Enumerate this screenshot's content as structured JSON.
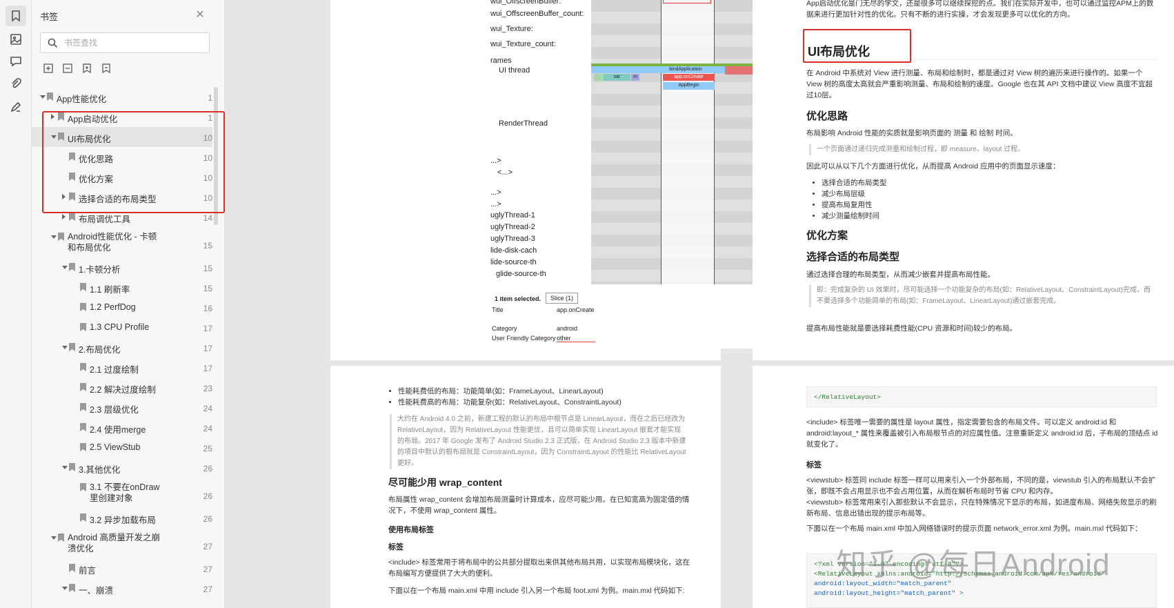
{
  "panel": {
    "title": "书签",
    "search_placeholder": "书签查找"
  },
  "rail": {
    "icons": [
      "bookmark-icon",
      "image-icon",
      "comment-icon",
      "attachment-icon",
      "signature-icon"
    ]
  },
  "tree": [
    {
      "label": "App性能优化",
      "page": "1"
    },
    {
      "label": "App启动优化",
      "page": "1"
    },
    {
      "label": "UI布局优化",
      "page": "10"
    },
    {
      "label": "优化思路",
      "page": "10"
    },
    {
      "label": "优化方案",
      "page": "10"
    },
    {
      "label": "选择合适的布局类型",
      "page": "10"
    },
    {
      "label": "布局调优工具",
      "page": "14"
    },
    {
      "label": "Android性能优化 - 卡顿和布局优化",
      "page": "15"
    },
    {
      "label": "1.卡顿分析",
      "page": "15"
    },
    {
      "label": "1.1 刷新率",
      "page": "15"
    },
    {
      "label": "1.2 PerfDog",
      "page": "16"
    },
    {
      "label": "1.3 CPU Profile",
      "page": "17"
    },
    {
      "label": "2.布局优化",
      "page": "17"
    },
    {
      "label": "2.1 过度绘制",
      "page": "17"
    },
    {
      "label": "2.2 解决过度绘制",
      "page": "23"
    },
    {
      "label": "2.3 层级优化",
      "page": "24"
    },
    {
      "label": "2.4 使用merge",
      "page": "24"
    },
    {
      "label": "2.5 ViewStub",
      "page": "25"
    },
    {
      "label": "3.其他优化",
      "page": "26"
    },
    {
      "label": "3.1 不要在onDraw里创建对象",
      "page": "26"
    },
    {
      "label": "3.2 异步加载布局",
      "page": "26"
    },
    {
      "label": "Android 高质量开发之崩溃优化",
      "page": "27"
    },
    {
      "label": "前言",
      "page": "27"
    },
    {
      "label": "一、崩溃",
      "page": "27"
    }
  ],
  "trace": {
    "lanes": [
      "wui_OffscreenBuffer:",
      "wui_OffscreenBuffer_count:",
      "wui_Texture:",
      "wui_Texture_count:",
      "rames",
      "UI thread",
      "RenderThread",
      "...>",
      "<...>",
      "...>",
      "...>",
      "uglyThread-1",
      "uglyThread-2",
      "uglyThread-3",
      "lide-disk-cach",
      "lide-source-th",
      "glide-source-th"
    ],
    "slices": [
      "bindApplication",
      "app.onCreate",
      "AppBegin",
      "sat",
      "m"
    ],
    "selection": "1 item selected.",
    "tab": "Slice (1)",
    "details": [
      {
        "k": "Title",
        "v": "app.onCreate"
      },
      {
        "k": "Category",
        "v": "android"
      },
      {
        "k": "User Friendly Category",
        "v": "other"
      }
    ]
  },
  "page_right_top": {
    "intro": "App启动优化是门无尽的学文，还是很多可以继续探挖的点。我们在实际开发中，也可以通过监控APM上的数据来进行更加针对性的优化。只有不断的进行实操，才会发现更多可以优化的方向。",
    "h1": "UI布局优化",
    "p1": "在 Android 中系统对 View 进行测量、布局和绘制时，都是通过对 View 树的遍历来进行操作的。如果一个 View 树的高度太高就会严重影响测量、布局和绘制的速度。Google 也在其 API 文档中建议 View 高度不宜超过10层。",
    "h2a": "优化思路",
    "p2": "布局影响 Android 性能的实质就是影响页面的 测量 和 绘制 时间。",
    "q1": "一个页面通过递归完成测量和绘制过程，即 measure、layout 过程。",
    "p3": "因此可以从以下几个方面进行优化，从而提高 Android 应用中的页面显示速度：",
    "bullets": [
      "选择合适的布局类型",
      "减少布局层级",
      "提高布局复用性",
      "减少测量绘制时间"
    ],
    "h2b": "优化方案",
    "h2c": "选择合适的布局类型",
    "p4": "通过选择合理的布局类型，从而减少嵌套并提高布局性能。",
    "q2": "即：完成复杂的 UI 效果时，尽可能选择一个功能复杂的布局(如：RelativeLayout、ConstraintLayout)完成，而不要选择多个功能简单的布局(如：FrameLayout、LinearLayout)通过嵌套完成。",
    "p5": "提高布局性能就是要选择耗费性能(CPU 资源和时间)较少的布局。"
  },
  "page_left_bottom": {
    "bullets": [
      "性能耗费低的布局：功能简单(如：FrameLayout、LinearLayout)",
      "性能耗费高的布局：功能复杂(如：RelativeLayout、ConstraintLayout)"
    ],
    "q1": "大约在 Android 4.0 之前，新建工程的默认的布局中根节点是 LinearLayout，而在之后已经改为 RelativeLayout，因为 RelativeLayout 性能更优，且可以简单实现 LinearLayout 嵌套才能实现的布局。2017 年 Google 发布了 Android Studio 2.3 正式版，在 Android Studio 2.3 版本中新建的项目中默认的根布局就是 ConstraintLayout，因为 ConstraintLayout 的性能比 RelativeLayout 更好。",
    "h2": "尽可能少用 wrap_content",
    "p1": "布局属性 wrap_content 会增加布局测量时计算成本，应尽可能少用。在已知宽高为固定值的情况下，不使用 wrap_content 属性。",
    "h3a": "使用布局标签",
    "h3b": "标签",
    "p2": "<include> 标签常用于将布局中的公共部分提取出来供其他布局共用，以实现布局模块化，这在布局编写方便提供了大大的便利。",
    "p3": "下面以在一个布局 main.xml 中用 include 引入另一个布局 foot.xml 为例。main.mxl 代码如下:"
  },
  "page_right_bottom": {
    "code1": "</RelativeLayout>",
    "p1": "<include> 标签唯一需要的属性是 layout 属性，指定需要包含的布局文件。可以定义 android:id 和 android:layout_* 属性来覆盖被引入布局根节点的对应属性值。注意重新定义 android:id 后，子布局的顶结点 id 就变化了。",
    "h3": "标签",
    "p2": "<viewstub> 标签同 include 标签一样可以用来引入一个外部布局，不同的是，viewstub 引入的布局默认不会扩张，即既不会占用显示也不会占用位置，从而在解析布局时节省 CPU 和内存。",
    "p3": "<viewstub> 标签常用来引入那些默认不会显示，只在特殊情况下显示的布局，如进度布局、网络失败显示的刷新布局、信息出错出现的提示布局等。",
    "p4": "下面以在一个布局 main.xml 中加入网络错误时的提示页面 network_error.xml 为例。main.mxl 代码如下：",
    "code2": [
      "<?xml version=\"1.0\" encoding=\"utf-8\"?>",
      "<RelativeLayout xmlns:android=\"http://schemas.android.com/apk/res/android\"",
      "    android:layout_width=\"match_parent\"",
      "    android:layout_height=\"match_parent\" >"
    ]
  },
  "watermark": "知乎 @每日Android"
}
